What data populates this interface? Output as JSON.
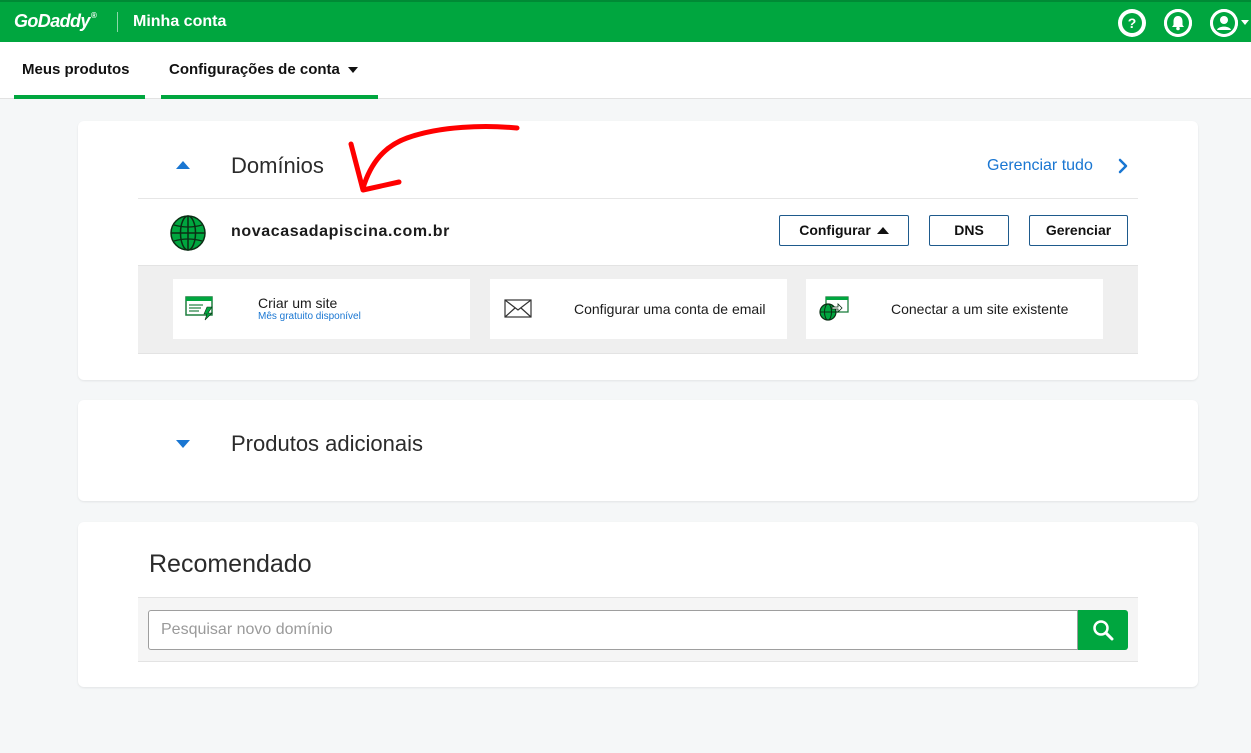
{
  "header": {
    "logo": "GoDaddy",
    "logo_mark": "®",
    "title": "Minha conta",
    "icons": [
      "help-icon",
      "bell-icon",
      "user-icon"
    ]
  },
  "nav": {
    "tabs": [
      {
        "label": "Meus produtos"
      },
      {
        "label": "Configurações de conta"
      }
    ]
  },
  "domains": {
    "title": "Domínios",
    "manage_all": "Gerenciar tudo",
    "domain": "novacasadapiscina.com.br",
    "buttons": {
      "configure": "Configurar",
      "dns": "DNS",
      "manage": "Gerenciar"
    },
    "actions": [
      {
        "title": "Criar um site",
        "subtitle": "Mês gratuito disponível",
        "icon": "website-builder-icon"
      },
      {
        "title": "Configurar uma conta de email",
        "icon": "email-envelope-icon"
      },
      {
        "title": "Conectar a um site existente",
        "icon": "connect-site-icon"
      }
    ]
  },
  "products": {
    "title": "Produtos adicionais"
  },
  "recommended": {
    "title": "Recomendado",
    "search_placeholder": "Pesquisar novo domínio",
    "search_value": ""
  },
  "colors": {
    "brand_green": "#00a63f",
    "link_blue": "#1976d2",
    "annotation_red": "#ff0000"
  }
}
